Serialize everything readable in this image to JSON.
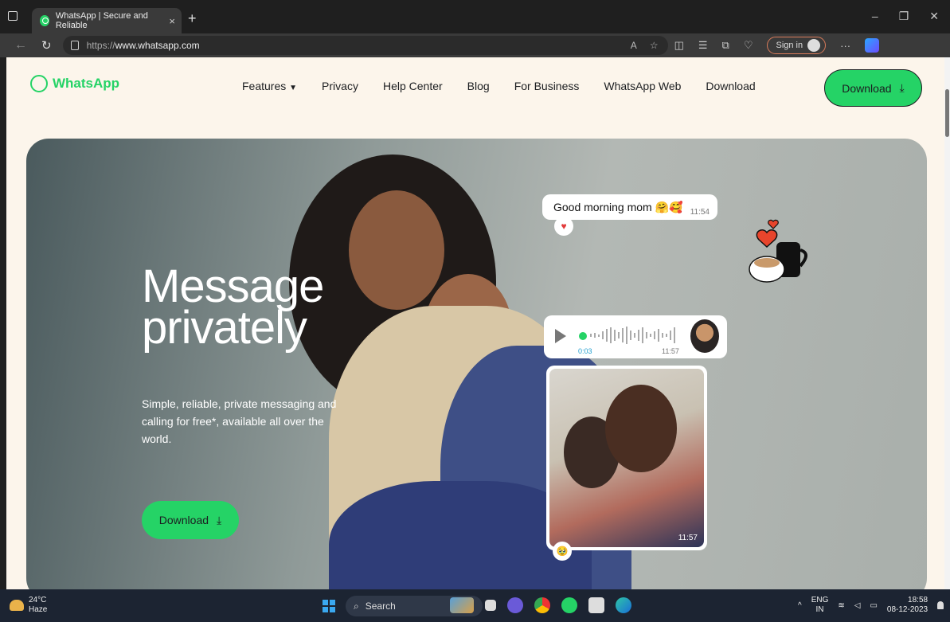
{
  "browser": {
    "tab_title": "WhatsApp | Secure and Reliable",
    "tab_close": "×",
    "new_tab": "+",
    "url_prefix": "https://",
    "url_domain": "www.whatsapp.com",
    "sign_in": "Sign in",
    "more": "···"
  },
  "site": {
    "logo_text": "WhatsApp",
    "nav": [
      "Features",
      "Privacy",
      "Help Center",
      "Blog",
      "For Business",
      "WhatsApp Web",
      "Download"
    ],
    "download_top": "Download",
    "hero": {
      "title_line1": "Message",
      "title_line2": "privately",
      "subtitle": "Simple, reliable, private messaging and calling for free*, available all over the world.",
      "download": "Download"
    },
    "chat": {
      "message": "Good morning mom 🤗🥰",
      "message_time": "11:54",
      "reaction": "♥",
      "voice_duration": "0:03",
      "voice_time": "11:57",
      "photo_time": "11:57",
      "photo_reaction": "🥹"
    }
  },
  "taskbar": {
    "temp": "24°C",
    "weather": "Haze",
    "search": "Search",
    "lang1": "ENG",
    "lang2": "IN",
    "time": "18:58",
    "date": "08-12-2023"
  },
  "colors": {
    "brand_green": "#25d366",
    "page_bg": "#fcf5eb"
  }
}
